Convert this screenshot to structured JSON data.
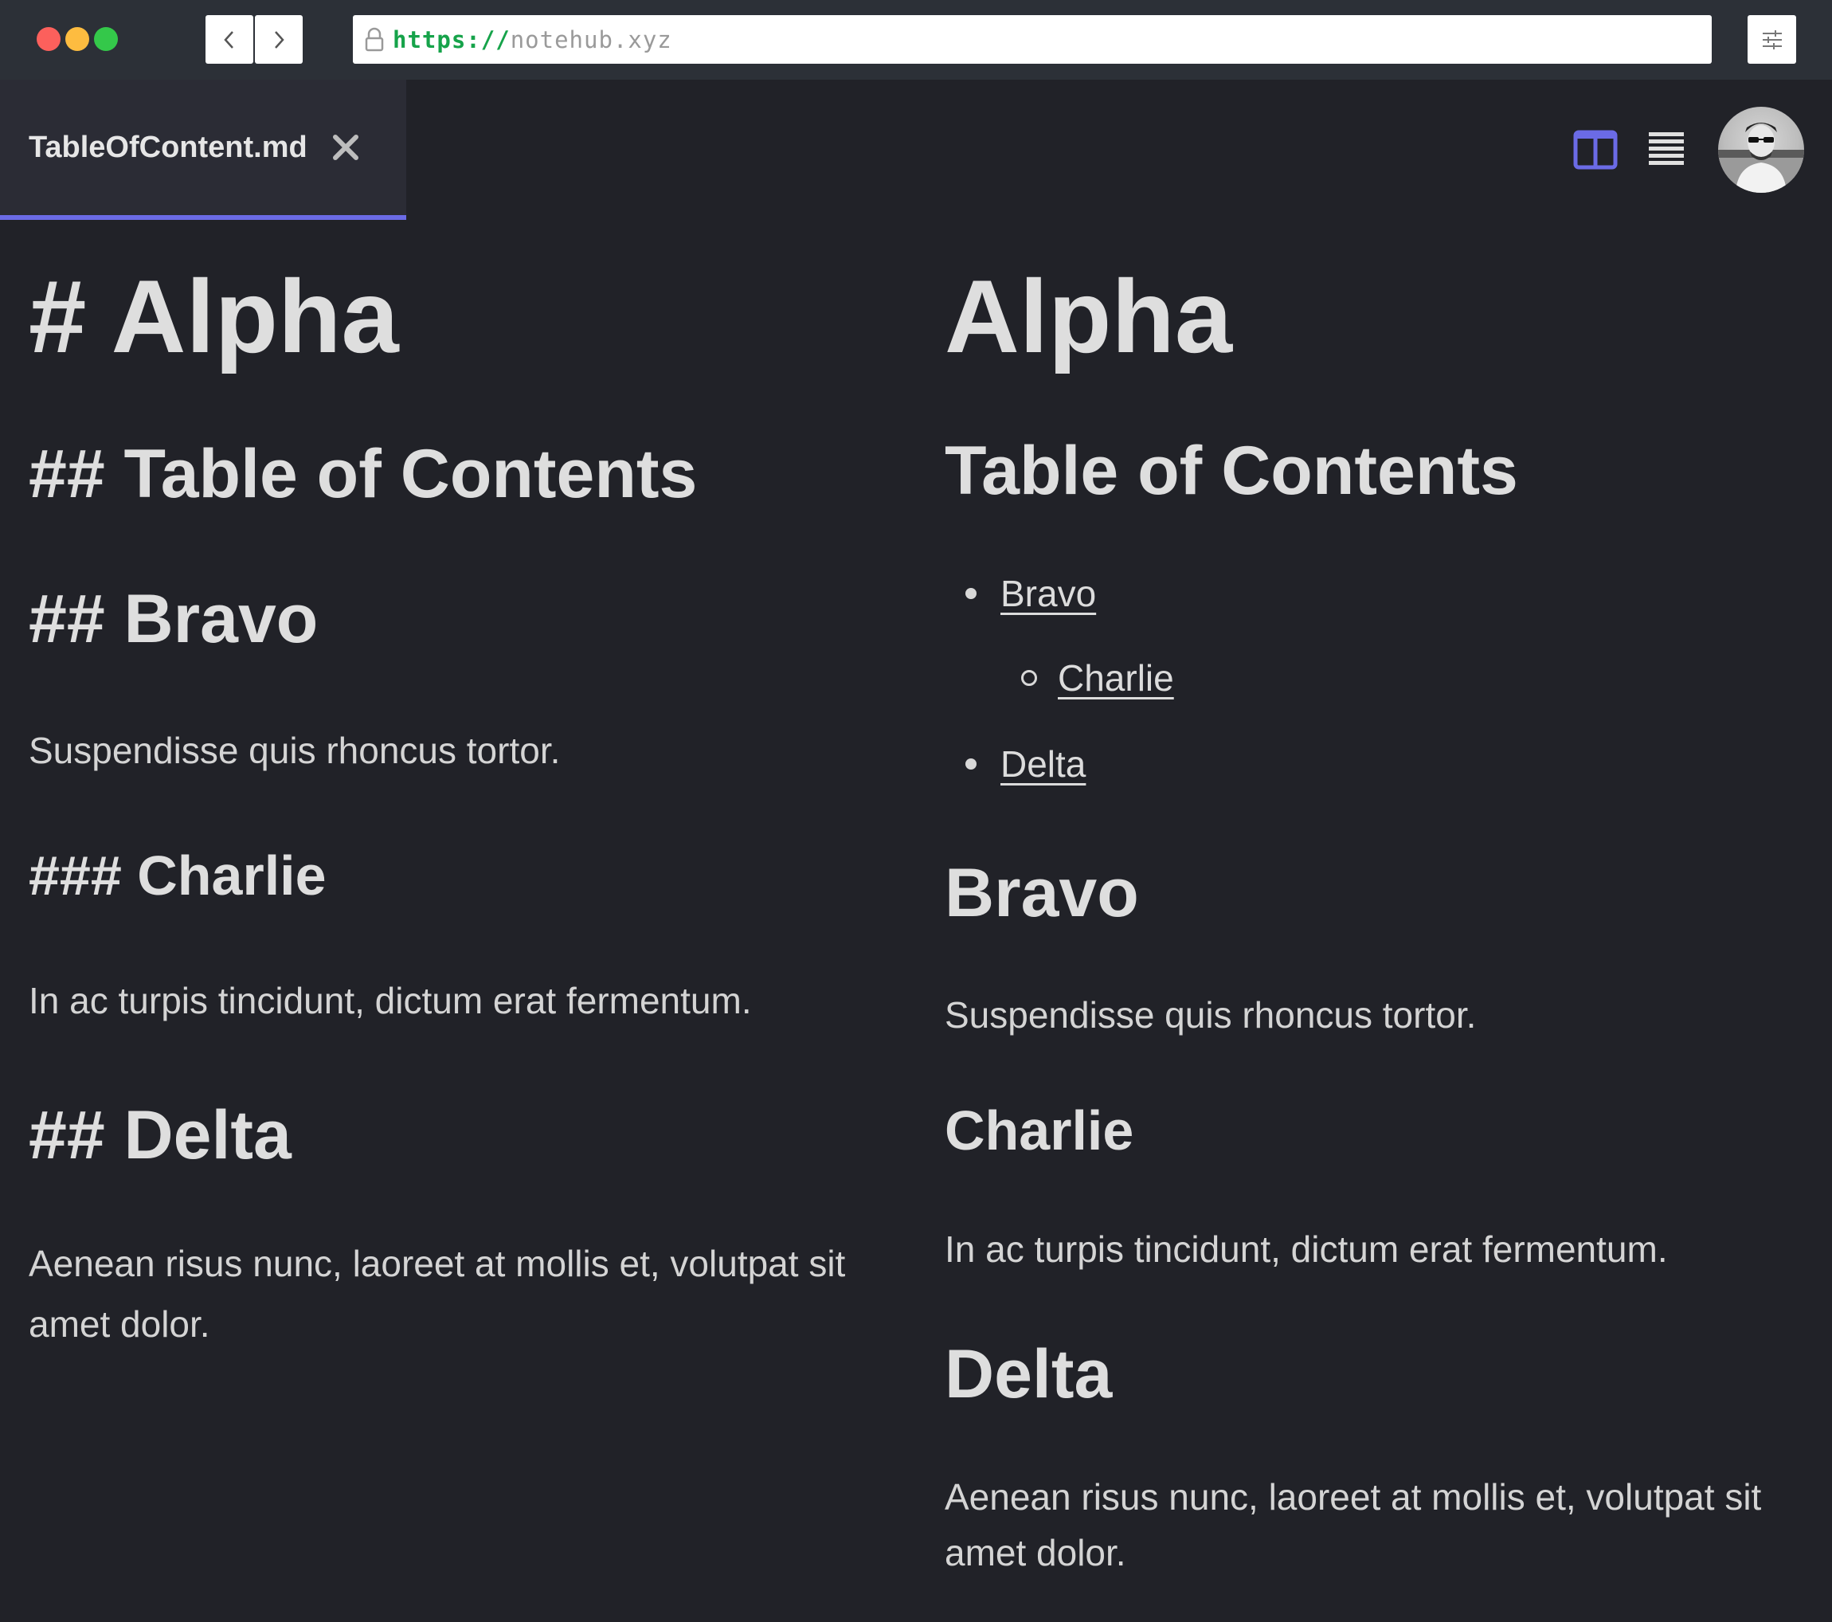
{
  "browser": {
    "url_scheme": "https://",
    "url_host": "notehub.xyz",
    "traffic_lights": [
      "close",
      "minimize",
      "maximize"
    ],
    "nav_icons": [
      "chevron-left-icon",
      "chevron-right-icon"
    ],
    "settings_icon": "sliders-icon",
    "lock_icon": "lock-icon"
  },
  "header": {
    "tab_title": "TableOfContent.md",
    "tab_close_icon": "close-icon",
    "view_icons": [
      "split-view-icon",
      "list-view-icon"
    ],
    "accent_color": "#6b6be6"
  },
  "editor": {
    "h1": "# Alpha",
    "toc_heading": "## Table of Contents",
    "bravo_heading": "## Bravo",
    "bravo_text": "Suspendisse quis rhoncus tortor.",
    "charlie_heading": "### Charlie",
    "charlie_text": "In ac turpis tincidunt, dictum erat fermentum.",
    "delta_heading": "## Delta",
    "delta_text": "Aenean risus nunc, laoreet at mollis et, volutpat sit amet dolor."
  },
  "preview": {
    "h1": "Alpha",
    "toc_heading": "Table of Contents",
    "toc": [
      {
        "label": "Bravo",
        "level": 1
      },
      {
        "label": "Charlie",
        "level": 2
      },
      {
        "label": "Delta",
        "level": 1
      }
    ],
    "bravo_heading": "Bravo",
    "bravo_text": "Suspendisse quis rhoncus tortor.",
    "charlie_heading": "Charlie",
    "charlie_text": "In ac turpis tincidunt, dictum erat fermentum.",
    "delta_heading": "Delta",
    "delta_text": "Aenean risus nunc, laoreet at mollis et, volutpat sit amet dolor."
  }
}
